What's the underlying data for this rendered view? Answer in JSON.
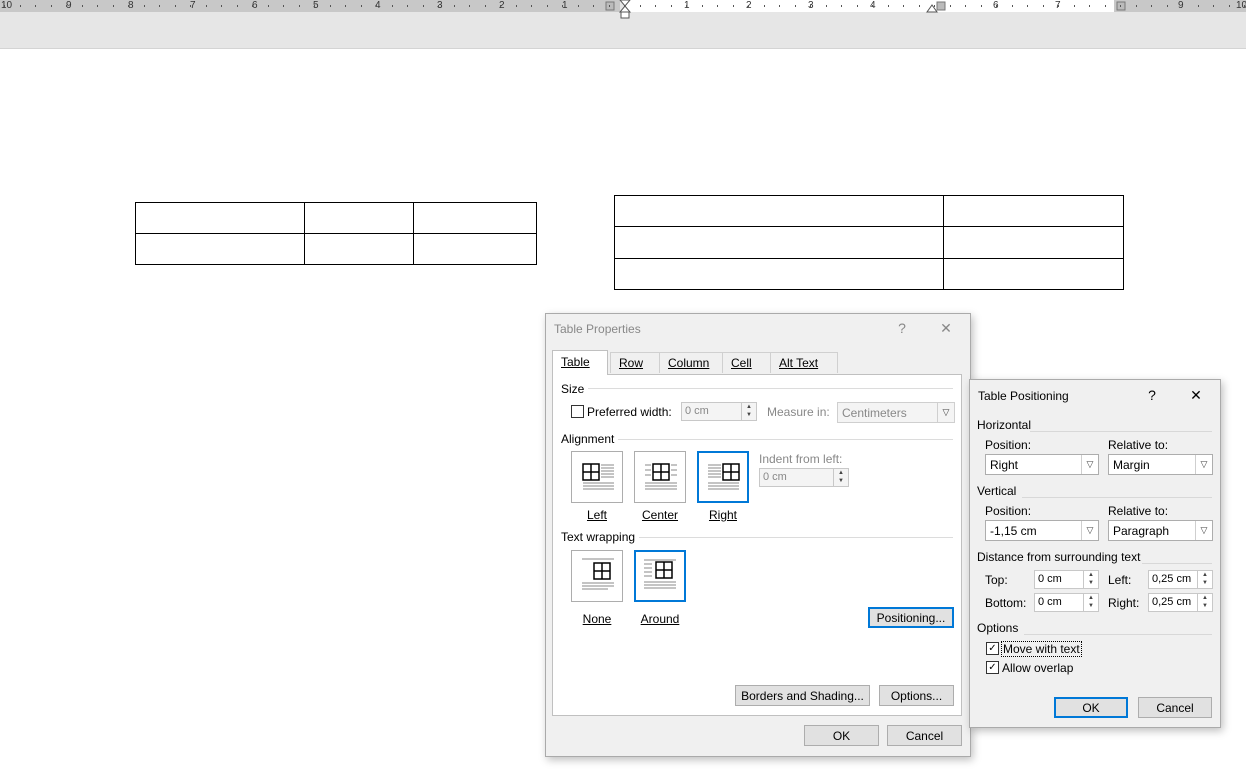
{
  "ruler": {
    "left_numbers": [
      "10",
      "9",
      "8",
      "7",
      "6",
      "5",
      "4",
      "3",
      "2",
      "1"
    ],
    "right_numbers": [
      "1",
      "2",
      "3",
      "4",
      "6",
      "7",
      "9",
      "10"
    ]
  },
  "table_properties": {
    "title": "Table Properties",
    "help": "?",
    "close": "✕",
    "tabs": [
      "Table",
      "Row",
      "Column",
      "Cell",
      "Alt Text"
    ],
    "size_label": "Size",
    "preferred_width_label": "Preferred width:",
    "preferred_width_value": "0 cm",
    "measure_in_label": "Measure in:",
    "measure_in_value": "Centimeters",
    "alignment_label": "Alignment",
    "align_left": "Left",
    "align_center": "Center",
    "align_right": "Right",
    "indent_label": "Indent from left:",
    "indent_value": "0 cm",
    "wrapping_label": "Text wrapping",
    "wrap_none": "None",
    "wrap_around": "Around",
    "positioning_btn": "Positioning...",
    "borders_btn": "Borders and Shading...",
    "options_btn": "Options...",
    "ok": "OK",
    "cancel": "Cancel"
  },
  "table_positioning": {
    "title": "Table Positioning",
    "help": "?",
    "close": "✕",
    "horizontal_label": "Horizontal",
    "h_position_label": "Position:",
    "h_position_value": "Right",
    "h_relative_label": "Relative to:",
    "h_relative_value": "Margin",
    "vertical_label": "Vertical",
    "v_position_label": "Position:",
    "v_position_value": "-1,15 cm",
    "v_relative_label": "Relative to:",
    "v_relative_value": "Paragraph",
    "distance_label": "Distance from surrounding text",
    "top_label": "Top:",
    "top_value": "0 cm",
    "bottom_label": "Bottom:",
    "bottom_value": "0 cm",
    "left_label": "Left:",
    "left_value": "0,25 cm",
    "right_label": "Right:",
    "right_value": "0,25 cm",
    "options_label": "Options",
    "move_with_text": "Move with text",
    "allow_overlap": "Allow overlap",
    "ok": "OK",
    "cancel": "Cancel"
  }
}
